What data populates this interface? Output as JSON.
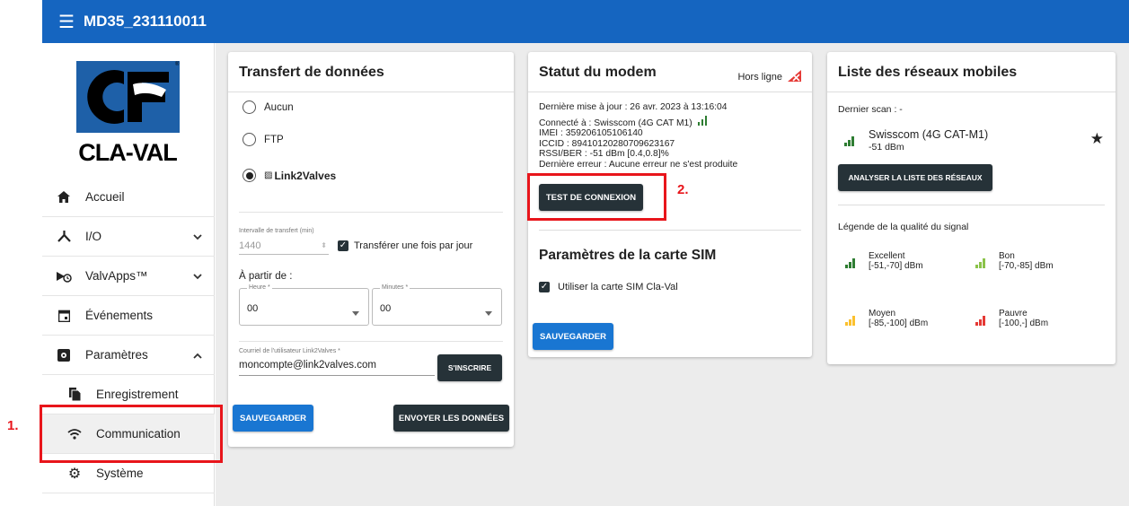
{
  "header": {
    "title": "MD35_231110011"
  },
  "logo_text": "CLA-VAL",
  "sidebar": {
    "items": [
      {
        "label": "Accueil",
        "icon": "home-icon"
      },
      {
        "label": "I/O",
        "icon": "io-icon"
      },
      {
        "label": "ValvApps™",
        "icon": "valvapps-icon"
      },
      {
        "label": "Événements",
        "icon": "calendar-icon"
      },
      {
        "label": "Paramètres",
        "icon": "settings-box-icon"
      },
      {
        "label": "Enregistrement",
        "icon": "file-copy-icon"
      },
      {
        "label": "Communication",
        "icon": "wifi-icon"
      },
      {
        "label": "Système",
        "icon": "gear-icon"
      }
    ]
  },
  "transfer": {
    "title": "Transfert de données",
    "options": [
      "Aucun",
      "FTP",
      "Link2Valves"
    ],
    "selected": "Link2Valves",
    "interval_label": "Intervalle de transfert (min)",
    "interval_value": "1440",
    "once_label": "Transférer une fois par jour",
    "from_label": "À partir de :",
    "hour_label": "Heure *",
    "hour_value": "00",
    "minutes_label": "Minutes *",
    "minutes_value": "00",
    "email_label": "Courriel de l'utilisateur Link2Valves *",
    "email_value": "moncompte@link2valves.com",
    "register_btn": "S'INSCRIRE",
    "save_btn": "SAUVEGARDER",
    "send_btn": "ENVOYER LES DONNÉES"
  },
  "modem": {
    "title": "Statut du modem",
    "status": "Hors ligne",
    "lines": [
      "Dernière mise à jour : 26 avr. 2023 à 13:16:04",
      "Connecté à : Swisscom (4G CAT M1)",
      "IMEI : 359206105106140",
      "ICCID : 89410120280709623167",
      "RSSI/BER : -51 dBm [0.4,0.8]%",
      "Dernière erreur : Aucune erreur ne s'est produite"
    ],
    "test_btn": "TEST DE CONNEXION",
    "sim_title": "Paramètres de la carte SIM",
    "sim_checkbox": "Utiliser la carte SIM Cla-Val",
    "save_btn": "SAUVEGARDER"
  },
  "networks": {
    "title": "Liste des réseaux mobiles",
    "last_scan": "Dernier scan : -",
    "network_name": "Swisscom (4G CAT-M1)",
    "network_signal": "-51 dBm",
    "scan_btn": "ANALYSER LA LISTE DES RÉSEAUX",
    "legend_title": "Légende de la qualité du signal",
    "legend": [
      {
        "name": "Excellent",
        "range": "[-51,-70] dBm",
        "color": "#2e7d32"
      },
      {
        "name": "Bon",
        "range": "[-70,-85] dBm",
        "color": "#8bc34a"
      },
      {
        "name": "Moyen",
        "range": "[-85,-100] dBm",
        "color": "#fbc02d"
      },
      {
        "name": "Pauvre",
        "range": "[-100,-] dBm",
        "color": "#e53935"
      }
    ]
  },
  "annotations": {
    "step1": "1.",
    "step2": "2."
  },
  "colors": {
    "primary": "#1565c0",
    "button_blue": "#1976d2",
    "button_dark": "#263238",
    "annotation_red": "#e8151b"
  }
}
